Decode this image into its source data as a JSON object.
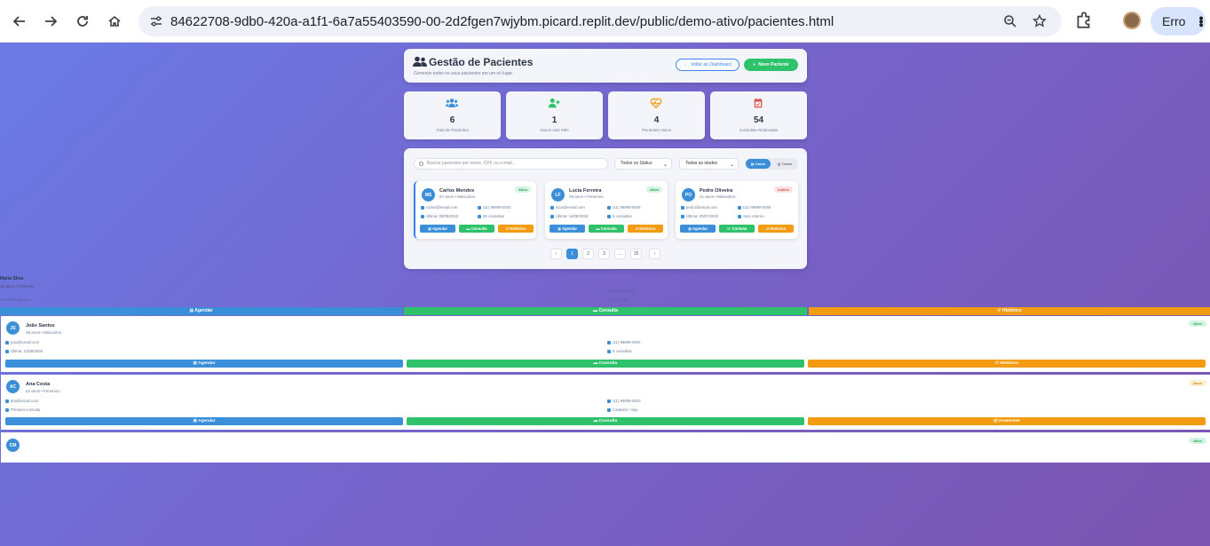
{
  "browser": {
    "url": "84622708-9db0-420a-a1f1-6a7a55403590-00-2d2fgen7wjybm.picard.replit.dev/public/demo-ativo/pacientes.html",
    "profile_label": "Erro"
  },
  "header": {
    "title": "Gestão de Pacientes",
    "subtitle": "Gerencie todos os seus pacientes em um só lugar",
    "back_label": "Voltar ao Dashboard",
    "new_label": "Novo Paciente"
  },
  "stats": [
    {
      "value": "6",
      "label": "Total de Pacientes",
      "icon": "users-icon",
      "color": "#3b8fd9"
    },
    {
      "value": "1",
      "label": "Novos este Mês",
      "icon": "user-plus-icon",
      "color": "#2ec36a"
    },
    {
      "value": "4",
      "label": "Pacientes Ativos",
      "icon": "heartbeat-icon",
      "color": "#f39c12"
    },
    {
      "value": "54",
      "label": "Consultas Realizadas",
      "icon": "calendar-check-icon",
      "color": "#e05353"
    }
  ],
  "filters": {
    "search_placeholder": "Buscar pacientes por nome, CPF ou e-mail...",
    "status_value": "Todos os Status",
    "age_value": "Todas as idades",
    "view_cards": "Cards",
    "view_table": "Tabela"
  },
  "cards": [
    {
      "initials": "MS",
      "name": "Carlos Mendes",
      "meta": "67 anos • Masculino",
      "status": "Ativo",
      "email": "carlos@email.com",
      "phone": "(11) 99999-0004",
      "last": "Última: 05/08/2025",
      "count": "25 consultas",
      "btn1": "Agendar",
      "btn2": "Consulta",
      "btn3": "Histórico"
    },
    {
      "initials": "LF",
      "name": "Lucia Ferreira",
      "meta": "29 anos • Feminino",
      "status": "Ativo",
      "email": "lucia@email.com",
      "phone": "(11) 99999-0005",
      "last": "Última: 14/08/2025",
      "count": "6 consultas",
      "btn1": "Agendar",
      "btn2": "Consulta",
      "btn3": "Histórico"
    },
    {
      "initials": "PO",
      "name": "Pedro Oliveira",
      "meta": "41 anos • Masculino",
      "status": "Inativo",
      "email": "pedro@email.com",
      "phone": "(11) 99999-0006",
      "last": "Última: 20/07/2025",
      "count": "Sem retorno",
      "btn1": "Agendar",
      "btn2": "Contatar",
      "btn3": "Histórico"
    }
  ],
  "pagination": [
    "‹",
    "1",
    "2",
    "3",
    "...",
    "15",
    "›"
  ],
  "overflow": {
    "stray_name": "Maria Silva",
    "stray_meta": "45 anos • Feminino",
    "stray_line1": "(11) 99999-0001",
    "stray_line2": "12 consultas",
    "stray_line3": "maria@email.com",
    "bar_btn1": "Agendar",
    "bar_btn2": "Consulta",
    "bar_btn3": "Histórico"
  },
  "wide_cards": [
    {
      "initials": "JS",
      "name": "João Santos",
      "meta": "38 anos • Masculino",
      "status": "Ativo",
      "email": "joao@email.com",
      "phone": "(11) 99999-0002",
      "last": "Última: 12/08/2025",
      "count": "8 consultas",
      "btn1": "Agendar",
      "btn2": "Consulta",
      "btn3": "Histórico"
    },
    {
      "initials": "AC",
      "name": "Ana Costa",
      "meta": "52 anos • Feminino",
      "status": "Novo",
      "email": "ana@email.com",
      "phone": "(11) 99999-0003",
      "last": "Primeira consulta",
      "count": "Cadastro: Hoje",
      "btn1": "Agendar",
      "btn2": "Consulta",
      "btn3": "Anamnese"
    },
    {
      "initials": "CM",
      "status": "Ativo"
    }
  ]
}
